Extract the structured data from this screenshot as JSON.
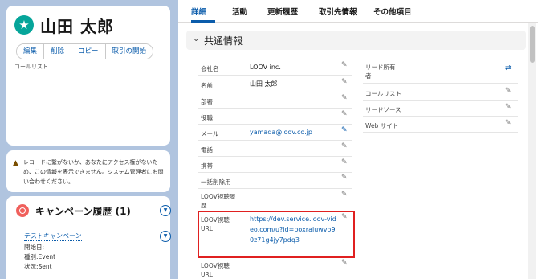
{
  "contact": {
    "name": "山田 太郎",
    "icon": "star-icon",
    "actions": [
      "編集",
      "削除",
      "コピー",
      "取引の開始"
    ],
    "call_list_label": "コールリスト"
  },
  "warning": {
    "text": "レコードに繋がないか、あなたにアクセス権がないため、この情報を表示できません。システム管理者にお問い合わせください。"
  },
  "campaign": {
    "title": "キャンペーン履歴 (1)",
    "link": "テストキャンペーン",
    "start_date": "開始日:",
    "type": "種別:Event",
    "status": "状況:Sent"
  },
  "tabs": [
    "詳細",
    "活動",
    "更新履歴",
    "取引先情報",
    "その他項目"
  ],
  "section": {
    "title": "共通情報"
  },
  "fields_left": [
    {
      "label": "会社名",
      "value": "LOOV inc."
    },
    {
      "label": "名前",
      "value": "山田 太郎"
    },
    {
      "label": "部署",
      "value": ""
    },
    {
      "label": "役職",
      "value": ""
    },
    {
      "label": "メール",
      "value": "yamada@loov.co.jp"
    },
    {
      "label": "電話",
      "value": ""
    },
    {
      "label": "携帯",
      "value": ""
    },
    {
      "label": "一括削除用",
      "value": ""
    },
    {
      "label": "LOOV視聴履歴",
      "value": ""
    },
    {
      "label": "LOOV視聴URL",
      "value": "https://dev.service.loov-video.com/u?id=poxraiuwvo90z71g4jy7pdq3"
    },
    {
      "label": "LOOV視聴URL",
      "value": ""
    }
  ],
  "fields_right": [
    {
      "label": "リード所有者",
      "value": ""
    },
    {
      "label": "コールリスト",
      "value": ""
    },
    {
      "label": "リードソース",
      "value": ""
    },
    {
      "label": "Web サイト",
      "value": ""
    }
  ]
}
